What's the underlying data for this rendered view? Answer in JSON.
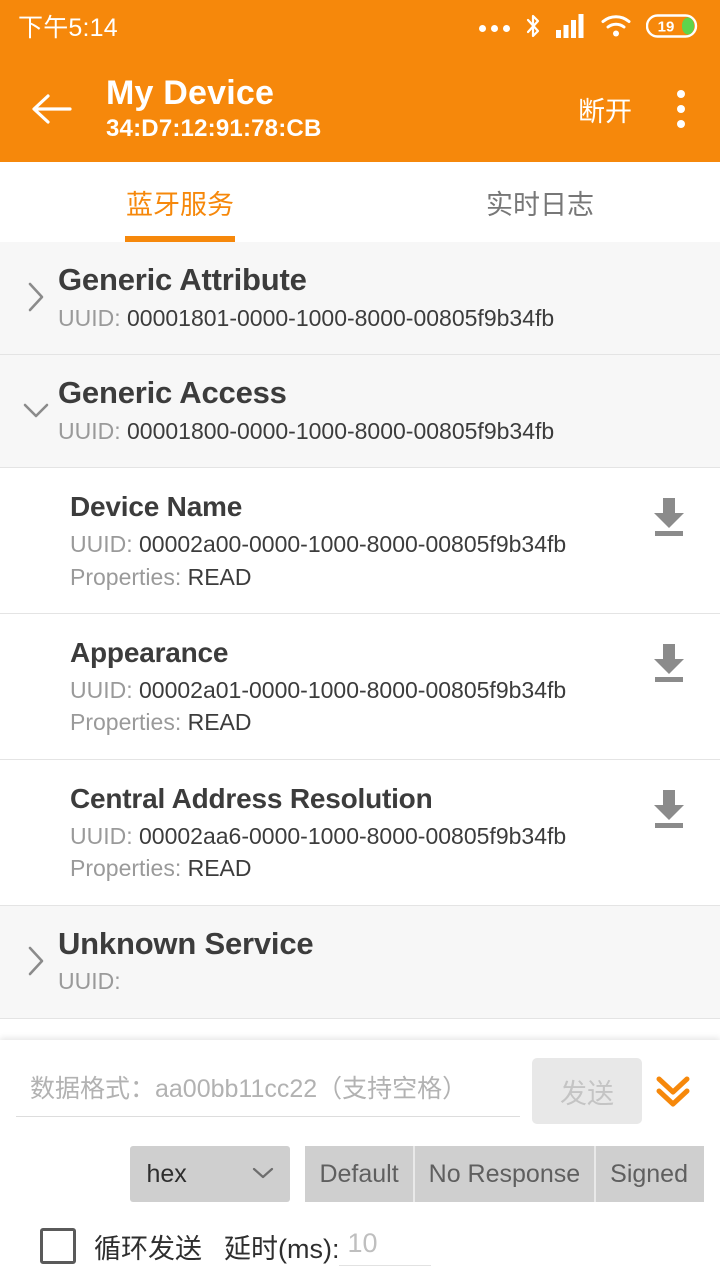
{
  "statusbar": {
    "time": "下午5:14",
    "icons": [
      "more-dots-icon",
      "bluetooth-icon",
      "cellular-signal-icon",
      "wifi-icon",
      "battery-icon"
    ],
    "battery_level": "19"
  },
  "appbar": {
    "back_icon": "arrow-left-icon",
    "device_name": "My Device",
    "device_address": "34:D7:12:91:78:CB",
    "disconnect_label": "断开",
    "overflow_icon": "more-vertical-icon",
    "background_color": "#F6880B"
  },
  "tabs": [
    {
      "label": "蓝牙服务",
      "active": true
    },
    {
      "label": "实时日志",
      "active": false
    }
  ],
  "labels": {
    "uuid_prefix": "UUID: ",
    "properties_prefix": "Properties: "
  },
  "services": [
    {
      "name": "Generic Attribute",
      "uuid": "00001801-0000-1000-8000-00805f9b34fb",
      "expanded": false,
      "chevron_icon": "chevron-right-icon",
      "characteristics": []
    },
    {
      "name": "Generic Access",
      "uuid": "00001800-0000-1000-8000-00805f9b34fb",
      "expanded": true,
      "chevron_icon": "chevron-down-icon",
      "characteristics": [
        {
          "name": "Device Name",
          "uuid": "00002a00-0000-1000-8000-00805f9b34fb",
          "properties": "READ",
          "action_icon": "download-icon"
        },
        {
          "name": "Appearance",
          "uuid": "00002a01-0000-1000-8000-00805f9b34fb",
          "properties": "READ",
          "action_icon": "download-icon"
        },
        {
          "name": "Central Address Resolution",
          "uuid": "00002aa6-0000-1000-8000-00805f9b34fb",
          "properties": "READ",
          "action_icon": "download-icon"
        }
      ]
    },
    {
      "name": "Unknown Service",
      "uuid": "",
      "expanded": false,
      "chevron_icon": "chevron-right-icon",
      "characteristics": []
    }
  ],
  "bottom_panel": {
    "data_input_value": "",
    "data_input_placeholder": "数据格式：aa00bb11cc22（支持空格）",
    "send_label": "发送",
    "send_enabled": false,
    "expand_icon": "chevrons-down-icon",
    "type_select_value": "hex",
    "type_select_chevron": "chevron-down-icon",
    "write_modes": [
      "Default",
      "No Response",
      "Signed"
    ],
    "loop_checkbox_checked": false,
    "loop_label": "循环发送",
    "delay_label": "延时(ms):",
    "delay_value": "",
    "delay_placeholder": "10"
  },
  "colors": {
    "accent": "#F6880B",
    "service_bg": "#F7F7F7",
    "divider": "#E4E4E4",
    "text_primary": "#3c3c3c",
    "text_secondary": "#9a9a9a"
  }
}
